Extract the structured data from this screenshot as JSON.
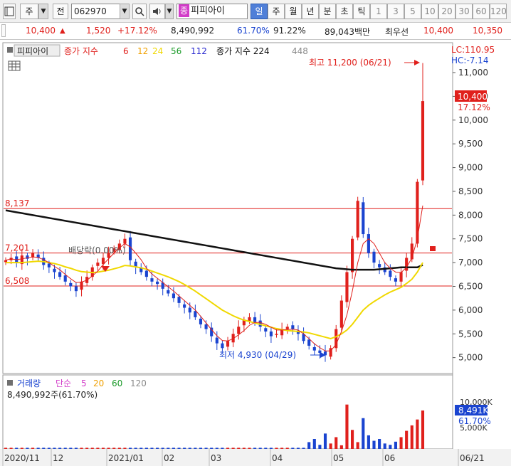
{
  "toolbar": {
    "market_label": "주",
    "ticker_label": "전",
    "stock_code": "062970",
    "stock_tag": "종",
    "stock_name": "피피아이",
    "period_tabs": [
      "일",
      "주",
      "월",
      "년",
      "분",
      "초",
      "틱"
    ],
    "selected_period": "일",
    "interval_buttons": [
      "1",
      "3",
      "5",
      "10",
      "20",
      "30",
      "60",
      "120"
    ]
  },
  "quote": {
    "price": "10,400",
    "change": "1,520",
    "change_pct": "+17.12%",
    "volume": "8,490,992",
    "volume_pct": "61.70%",
    "turnover_pct": "91.22%",
    "trade_value": "89,043백만",
    "best_offer_label": "최우선",
    "ask": "10,400",
    "bid": "10,350"
  },
  "price_panel": {
    "stock_label": "피피아이",
    "ma_label": "종가 지수",
    "ma_periods": [
      "6",
      "12",
      "24",
      "56",
      "112"
    ],
    "ma2_label": "종가 지수 224",
    "ma2_extra": "448",
    "lc_label": "LC:110.95",
    "hc_label": "HC:-7.14",
    "high_annotation": "최고 11,200 (06/21)",
    "low_annotation": "최저 4,930 (04/29)",
    "dividend_label": "배당락(0.00%)",
    "current_price_tag": "10,400",
    "current_pct_tag": "17.12%",
    "ref_lines": [
      {
        "label": "8,137",
        "value": 8137
      },
      {
        "label": "7,201",
        "value": 7201
      },
      {
        "label": "6,508",
        "value": 6508
      }
    ],
    "y_ticks": [
      "11,000",
      "10,500",
      "10,000",
      "9,500",
      "9,000",
      "8,500",
      "8,000",
      "7,500",
      "7,000",
      "6,500",
      "6,000",
      "5,500",
      "5,000"
    ]
  },
  "volume_panel": {
    "title": "거래량",
    "ma_label": "단순",
    "ma_periods": [
      "5",
      "20",
      "60",
      "120"
    ],
    "volume_text": "8,490,992주(61.70%)",
    "y_ticks": [
      "10,000K",
      "5,000K"
    ],
    "current_tag": "8,491K",
    "current_pct": "61.70%"
  },
  "x_axis": {
    "labels": [
      "2020/11",
      "12",
      "2021/01",
      "02",
      "03",
      "04",
      "05",
      "06",
      "06/21"
    ]
  },
  "colors": {
    "up": "#e0201c",
    "down": "#1a44d0",
    "ma6": "#e0201c",
    "ma12": "#f0a000",
    "ma24": "#f0d800",
    "ma56": "#1a9a28",
    "ma112": "#2a2ad0",
    "ma224": "#111111",
    "ma448": "#8a8a8a"
  },
  "chart_data": {
    "type": "candlestick",
    "price_range": [
      4800,
      11300
    ],
    "reference_lines": [
      8137,
      7201,
      6508
    ],
    "high": {
      "value": 11200,
      "date": "06/21"
    },
    "low": {
      "value": 4930,
      "date": "04/29"
    },
    "last": 10400,
    "close_series": [
      7050,
      7100,
      7000,
      7150,
      7080,
      7200,
      7100,
      6950,
      6900,
      6800,
      6700,
      6600,
      6500,
      6400,
      6600,
      6700,
      6900,
      7000,
      7100,
      7200,
      7300,
      7400,
      7500,
      7050,
      6900,
      6800,
      6700,
      6600,
      6550,
      6450,
      6350,
      6250,
      6150,
      6050,
      5950,
      5850,
      5700,
      5600,
      5450,
      5300,
      5200,
      5350,
      5500,
      5650,
      5800,
      5850,
      5750,
      5650,
      5550,
      5450,
      5500,
      5600,
      5650,
      5600,
      5500,
      5350,
      5250,
      5150,
      5100,
      5050,
      5200,
      5600,
      6200,
      6800,
      7500,
      8300,
      7600,
      7200,
      7000,
      6900,
      6800,
      6700,
      6600,
      6800,
      7100,
      7400,
      8700,
      10400
    ],
    "ma_6": [
      7050,
      7080,
      7060,
      7080,
      7100,
      7120,
      7110,
      7060,
      7000,
      6920,
      6850,
      6750,
      6660,
      6580,
      6590,
      6630,
      6720,
      6820,
      6960,
      7080,
      7200,
      7310,
      7400,
      7330,
      7200,
      7060,
      6880,
      6760,
      6670,
      6580,
      6490,
      6400,
      6300,
      6200,
      6100,
      6000,
      5870,
      5730,
      5590,
      5460,
      5360,
      5350,
      5400,
      5480,
      5570,
      5680,
      5740,
      5740,
      5700,
      5640,
      5580,
      5580,
      5590,
      5600,
      5580,
      5500,
      5400,
      5290,
      5210,
      5140,
      5140,
      5280,
      5550,
      5900,
      6400,
      7000,
      7400,
      7500,
      7400,
      7200,
      7000,
      6880,
      6800,
      6790,
      6900,
      7100,
      7500,
      8200
    ],
    "ma_24": [
      7000,
      7000,
      7000,
      7000,
      7010,
      7020,
      7030,
      7020,
      7000,
      6980,
      6950,
      6910,
      6880,
      6840,
      6810,
      6800,
      6790,
      6800,
      6820,
      6840,
      6870,
      6900,
      6940,
      6930,
      6910,
      6890,
      6860,
      6820,
      6780,
      6740,
      6700,
      6650,
      6600,
      6540,
      6470,
      6400,
      6320,
      6240,
      6160,
      6080,
      6000,
      5940,
      5880,
      5830,
      5790,
      5760,
      5730,
      5700,
      5670,
      5640,
      5610,
      5590,
      5570,
      5560,
      5550,
      5540,
      5520,
      5490,
      5460,
      5430,
      5400,
      5440,
      5500,
      5580,
      5700,
      5850,
      6000,
      6100,
      6180,
      6250,
      6320,
      6380,
      6430,
      6480,
      6560,
      6650,
      6800,
      7000
    ],
    "ma_224": [
      8100,
      8080,
      8060,
      8040,
      8020,
      8000,
      7980,
      7960,
      7940,
      7920,
      7900,
      7880,
      7860,
      7840,
      7820,
      7800,
      7780,
      7760,
      7740,
      7720,
      7700,
      7680,
      7660,
      7640,
      7620,
      7600,
      7580,
      7560,
      7540,
      7520,
      7500,
      7480,
      7460,
      7440,
      7420,
      7400,
      7380,
      7360,
      7340,
      7320,
      7300,
      7280,
      7260,
      7240,
      7220,
      7200,
      7180,
      7160,
      7140,
      7120,
      7100,
      7080,
      7060,
      7040,
      7020,
      7000,
      6980,
      6960,
      6940,
      6920,
      6900,
      6880,
      6870,
      6860,
      6850,
      6850,
      6850,
      6850,
      6850,
      6860,
      6870,
      6880,
      6890,
      6900,
      6900,
      6900,
      6900,
      6950
    ],
    "volume_tail": [
      1500,
      2200,
      900,
      3400,
      1200,
      2600,
      800,
      9800,
      4200,
      1500,
      6800,
      3000,
      1800,
      2200,
      1200,
      900,
      1600,
      2600,
      4000,
      5200,
      6500,
      8491
    ]
  }
}
